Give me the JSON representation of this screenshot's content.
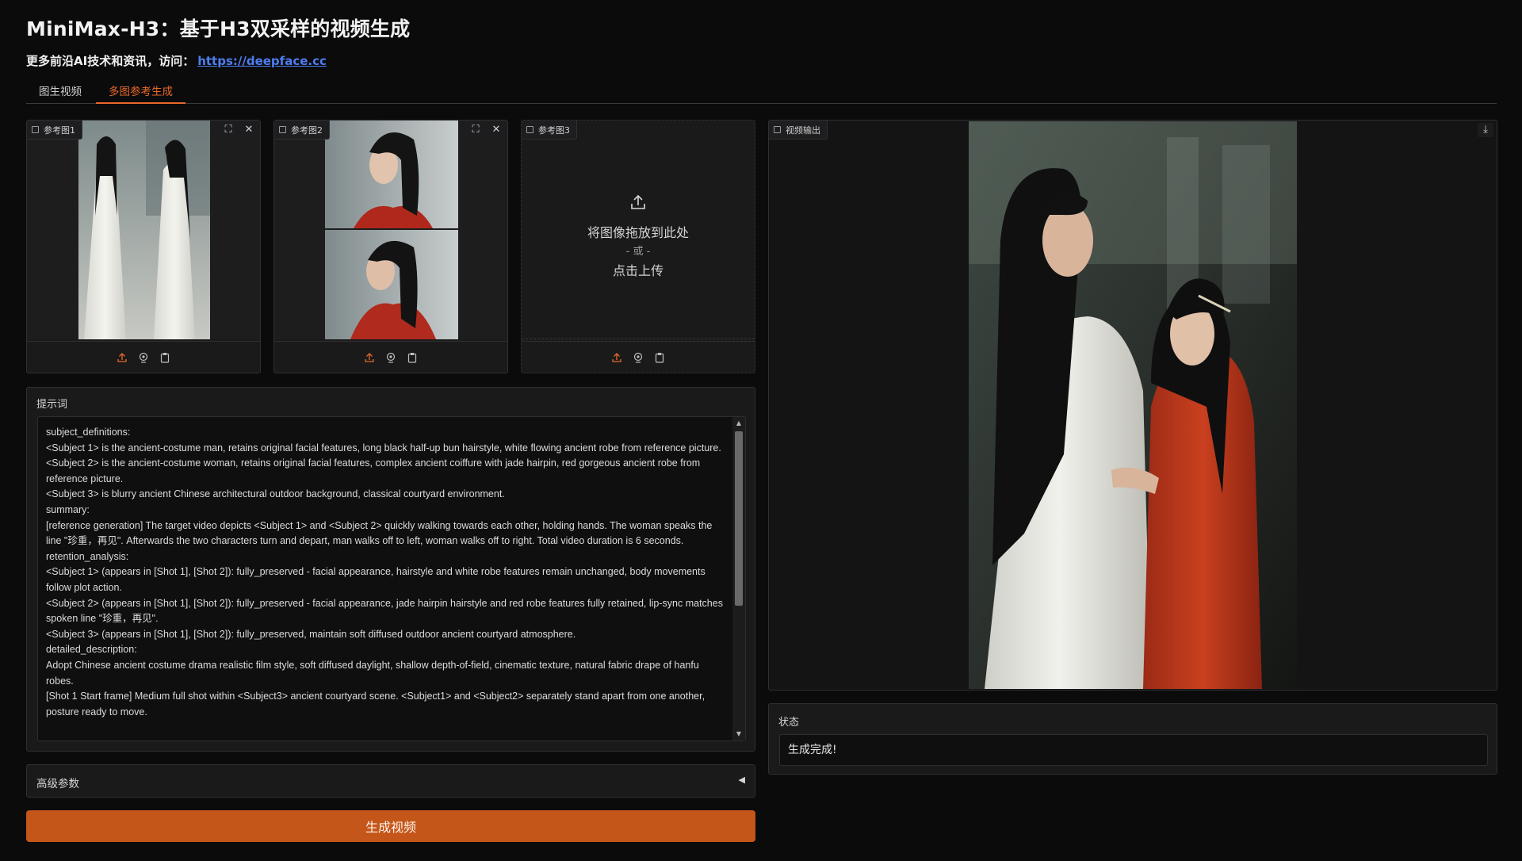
{
  "header": {
    "title": "MiniMax-H3：基于H3双采样的视频生成",
    "subtitle": "更多前沿AI技术和资讯，访问：",
    "link_text": "https://deepface.cc"
  },
  "tabs": [
    {
      "label": "图生视频",
      "active": false
    },
    {
      "label": "多图参考生成",
      "active": true
    }
  ],
  "reference_images": [
    {
      "label": "参考图1",
      "has_image": true
    },
    {
      "label": "参考图2",
      "has_image": true
    },
    {
      "label": "参考图3",
      "has_image": false
    }
  ],
  "upload": {
    "drop_text": "将图像拖放到此处",
    "or_text": "- 或 -",
    "click_text": "点击上传"
  },
  "prompt": {
    "label": "提示词",
    "value": "subject_definitions:\n<Subject 1> is the ancient-costume man, retains original facial features, long black half-up bun hairstyle, white flowing ancient robe from reference picture.\n<Subject 2> is the ancient-costume woman, retains original facial features, complex ancient coiffure with jade hairpin, red gorgeous ancient robe from reference picture.\n<Subject 3> is blurry ancient Chinese architectural outdoor background, classical courtyard environment.\nsummary:\n[reference generation] The target video depicts <Subject 1> and <Subject 2> quickly walking towards each other, holding hands. The woman speaks the line \"珍重，再见\". Afterwards the two characters turn and depart, man walks off to left, woman walks off to right. Total video duration is 6 seconds.\nretention_analysis:\n<Subject 1> (appears in [Shot 1], [Shot 2]): fully_preserved - facial appearance, hairstyle and white robe features remain unchanged, body movements follow plot action.\n<Subject 2> (appears in [Shot 1], [Shot 2]): fully_preserved - facial appearance, jade hairpin hairstyle and red robe features fully retained, lip-sync matches spoken line \"珍重，再见\".\n<Subject 3> (appears in [Shot 1], [Shot 2]): fully_preserved, maintain soft diffused outdoor ancient courtyard atmosphere.\ndetailed_description:\nAdopt Chinese ancient costume drama realistic film style, soft diffused daylight, shallow depth-of-field, cinematic texture, natural fabric drape of hanfu robes.\n[Shot 1 Start frame] Medium full shot within <Subject3> ancient courtyard scene. <Subject1> and <Subject2> separately stand apart from one another, posture ready to move."
  },
  "advanced": {
    "label": "高级参数",
    "arrow": "◀"
  },
  "generate_button": "生成视频",
  "video_output": {
    "label": "视频输出"
  },
  "status": {
    "label": "状态",
    "value": "生成完成!"
  },
  "colors": {
    "accent": "#e8692a",
    "button": "#c4561a",
    "link": "#4f7df0",
    "background": "#0b0b0c"
  }
}
